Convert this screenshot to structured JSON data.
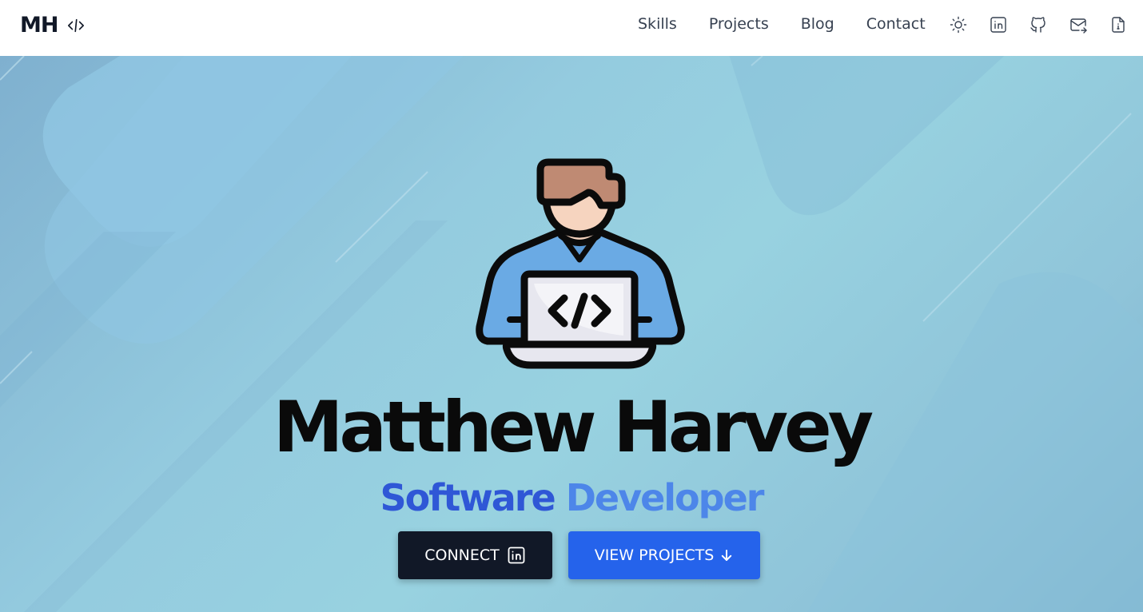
{
  "brand": {
    "initials": "MH",
    "icon": "code-icon"
  },
  "nav": {
    "links": [
      "Skills",
      "Projects",
      "Blog",
      "Contact"
    ],
    "icons": [
      "sun-icon",
      "linkedin-icon",
      "github-icon",
      "mail-icon",
      "resume-icon"
    ]
  },
  "hero": {
    "avatar_icon": "developer-avatar-icon",
    "name": "Matthew Harvey",
    "role_first": "Software",
    "role_second": "Developer",
    "connect_label": "CONNECT",
    "connect_icon": "linkedin-icon",
    "projects_label": "VIEW PROJECTS",
    "projects_icon": "arrow-down-icon"
  },
  "colors": {
    "nav_background": "#ffffff",
    "connect_button": "#111827",
    "projects_button": "#2563eb",
    "role_first": "#2f57d6",
    "role_second": "#4d86e9"
  }
}
